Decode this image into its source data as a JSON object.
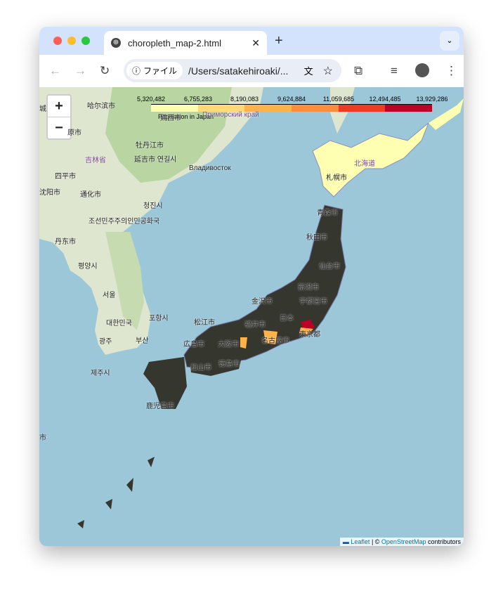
{
  "browser": {
    "tab_title": "choropleth_map-2.html",
    "chip_label": "ファイル",
    "url": "/Users/satakehiroaki/...",
    "icons": [
      "globe-icon",
      "close-icon",
      "plus-icon",
      "chevron-down-icon",
      "back-icon",
      "forward-icon",
      "reload-icon",
      "info-icon",
      "translate-icon",
      "star-icon",
      "extensions-icon",
      "media-icon",
      "avatar",
      "menu-icon"
    ]
  },
  "map": {
    "zoom_in": "+",
    "zoom_out": "−",
    "legend": {
      "caption": "Population in Japan",
      "ticks": [
        "5,320,482",
        "6,755,283",
        "8,190,083",
        "9,624,884",
        "11,059,685",
        "12,494,485",
        "13,929,286"
      ],
      "colors": [
        "#ffffb2",
        "#fed976",
        "#feb24c",
        "#fd8d3c",
        "#f03b20",
        "#bd0026"
      ]
    },
    "labels": [
      {
        "t": "哈尔滨市"
      },
      {
        "t": "城"
      },
      {
        "t": "原市"
      },
      {
        "t": "吉林省"
      },
      {
        "t": "牡丹江市"
      },
      {
        "t": "延吉市 연길시"
      },
      {
        "t": "四平市"
      },
      {
        "t": "沈阳市"
      },
      {
        "t": "通化市"
      },
      {
        "t": "Владивосток"
      },
      {
        "t": "鶏西市"
      },
      {
        "t": "Приморский край"
      },
      {
        "t": "청진시"
      },
      {
        "t": "조선민주주의인민공화국"
      },
      {
        "t": "丹东市"
      },
      {
        "t": "평양시"
      },
      {
        "t": "서울"
      },
      {
        "t": "대한민국"
      },
      {
        "t": "포항시"
      },
      {
        "t": "광주"
      },
      {
        "t": "부산"
      },
      {
        "t": "제주시"
      },
      {
        "t": "札幌市"
      },
      {
        "t": "北海道"
      },
      {
        "t": "青森市"
      },
      {
        "t": "秋田市"
      },
      {
        "t": "仙台市"
      },
      {
        "t": "新潟市"
      },
      {
        "t": "金沢市"
      },
      {
        "t": "宇都宮市"
      },
      {
        "t": "日本"
      },
      {
        "t": "松江市"
      },
      {
        "t": "福井市"
      },
      {
        "t": "名古屋市"
      },
      {
        "t": "東京都"
      },
      {
        "t": "大阪市"
      },
      {
        "t": "広島市"
      },
      {
        "t": "松山市"
      },
      {
        "t": "徳島市"
      },
      {
        "t": "鹿児島市"
      },
      {
        "t": "市"
      }
    ],
    "attribution": {
      "leaflet": "Leaflet",
      "sep": " | © ",
      "osm": "OpenStreetMap",
      "tail": " contributors"
    }
  }
}
